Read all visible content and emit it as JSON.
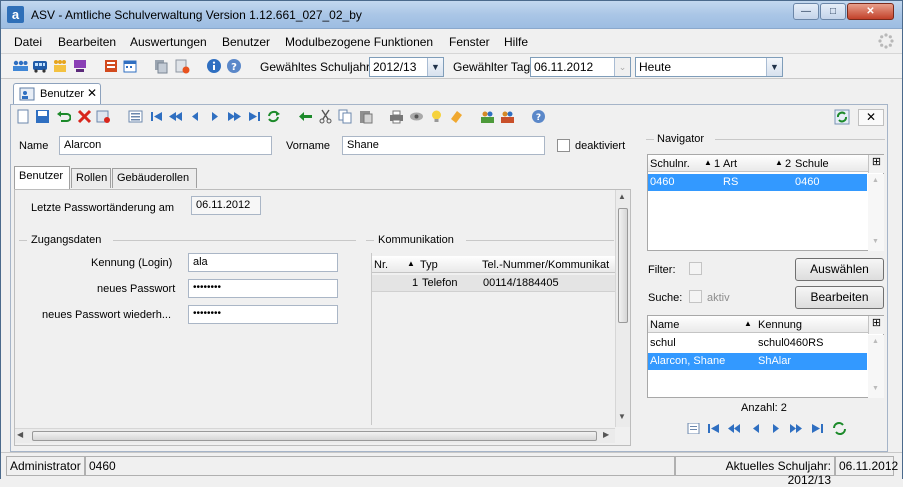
{
  "window": {
    "title": "ASV - Amtliche Schulverwaltung Version 1.12.661_027_02_by",
    "logo": "a"
  },
  "menu": [
    "Datei",
    "Bearbeiten",
    "Auswertungen",
    "Benutzer",
    "Modulbezogene Funktionen",
    "Fenster",
    "Hilfe"
  ],
  "toolbar": {
    "schuljahr_label": "Gewähltes Schuljahr",
    "schuljahr_value": "2012/13",
    "tag_label": "Gewählter Tag",
    "tag_value": "06.11.2012",
    "heute_value": "Heute"
  },
  "doc_tab": {
    "label": "Benutzer"
  },
  "person": {
    "name_label": "Name",
    "name_value": "Alarcon",
    "vorname_label": "Vorname",
    "vorname_value": "Shane",
    "deaktiviert_label": "deaktiviert"
  },
  "tabs": [
    "Benutzer",
    "Rollen",
    "Gebäuderollen"
  ],
  "benutzer": {
    "pw_change_label": "Letzte Passwortänderung am",
    "pw_change_value": "06.11.2012",
    "zugangsdaten_title": "Zugangsdaten",
    "login_label": "Kennung (Login)",
    "login_value": "ala",
    "pw_label": "neues Passwort",
    "pw_value": "••••••••",
    "pw2_label": "neues Passwort wiederh...",
    "pw2_value": "••••••••"
  },
  "kommunikation": {
    "title": "Kommunikation",
    "columns": [
      "Nr.",
      "Typ",
      "Tel.-Nummer/Kommunikat"
    ],
    "rows": [
      {
        "nr": "1",
        "typ": "Telefon",
        "nummer": "00114/1884405"
      }
    ]
  },
  "navigator": {
    "title": "Navigator",
    "columns": [
      "Schulnr.",
      "1",
      "Art",
      "2",
      "Schule"
    ],
    "row": {
      "schulnr": "0460",
      "art": "RS",
      "schule": "0460"
    },
    "filter_label": "Filter:",
    "suche_label": "Suche:",
    "aktiv_label": "aktiv",
    "auswaehlen_label": "Auswählen",
    "bearbeiten_label": "Bearbeiten",
    "list_columns": [
      "Name",
      "Kennung"
    ],
    "list_rows": [
      {
        "name": "schul",
        "kennung": "schul0460RS"
      },
      {
        "name": "Alarcon, Shane",
        "kennung": "ShAlar"
      }
    ],
    "anzahl": "Anzahl: 2"
  },
  "status": {
    "user": "Administrator",
    "schule": "0460",
    "schuljahr": "Aktuelles Schuljahr: 2012/13",
    "datum": "06.11.2012"
  }
}
